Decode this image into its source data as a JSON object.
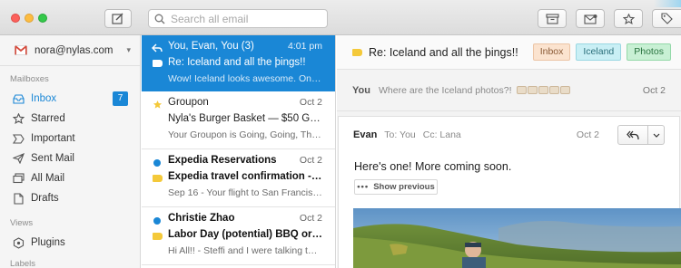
{
  "toolbar": {
    "search_placeholder": "Search all email",
    "compose_icon": "compose-icon",
    "archive_icon": "archive-icon",
    "move_icon": "move-to-folder-icon",
    "star_icon": "star-icon",
    "tag_icon": "tag-icon"
  },
  "sidebar": {
    "account_email": "nora@nylas.com",
    "sections": {
      "mailboxes": "Mailboxes",
      "views": "Views",
      "labels": "Labels"
    },
    "items": [
      {
        "label": "Inbox",
        "icon": "inbox-icon",
        "count": "7"
      },
      {
        "label": "Starred",
        "icon": "star-icon"
      },
      {
        "label": "Important",
        "icon": "important-icon"
      },
      {
        "label": "Sent Mail",
        "icon": "sent-icon"
      },
      {
        "label": "All Mail",
        "icon": "all-mail-icon"
      },
      {
        "label": "Drafts",
        "icon": "drafts-icon"
      }
    ],
    "views": [
      {
        "label": "Plugins",
        "icon": "plugins-icon"
      }
    ]
  },
  "threads": [
    {
      "sender": "You, Evan, You (3)",
      "date": "4:01 pm",
      "subject": "Re: Iceland and all the þings!!",
      "snippet": "Wow! Iceland looks awesome. On Sa..."
    },
    {
      "sender": "Groupon",
      "date": "Oct 2",
      "subject": "Nyla's Burger Basket — $50 Groupo...",
      "snippet": "Your Groupon is Going, Going, The..."
    },
    {
      "sender": "Expedia Reservations",
      "date": "Oct 2",
      "subject": "Expedia travel confirmation - Se...",
      "snippet": "Sep 16 - Your flight to San Francisco..."
    },
    {
      "sender": "Christie Zhao",
      "date": "Oct 2",
      "subject": "Labor Day (potential) BBQ or Pi...",
      "snippet": "Hi All!! - Steffi and I were talking tongi..."
    }
  ],
  "message_pane": {
    "subject": "Re: Iceland and all the þings!!",
    "labels": [
      "Inbox",
      "Iceland",
      "Photos"
    ],
    "collapsed": {
      "from": "You",
      "snippet": "Where are the Iceland photos?!",
      "date": "Oct 2"
    },
    "message": {
      "from": "Evan",
      "to": "To: You",
      "cc": "Cc: Lana",
      "date": "Oct 2",
      "body": "Here's one! More coming soon.",
      "show_previous": "Show previous"
    }
  },
  "colors": {
    "accent": "#1a87d6",
    "label_inbox": "#fbe3cf",
    "label_iceland": "#c9eff5",
    "label_photos": "#c8f0d4",
    "tag_yellow": "#f4c93a"
  }
}
